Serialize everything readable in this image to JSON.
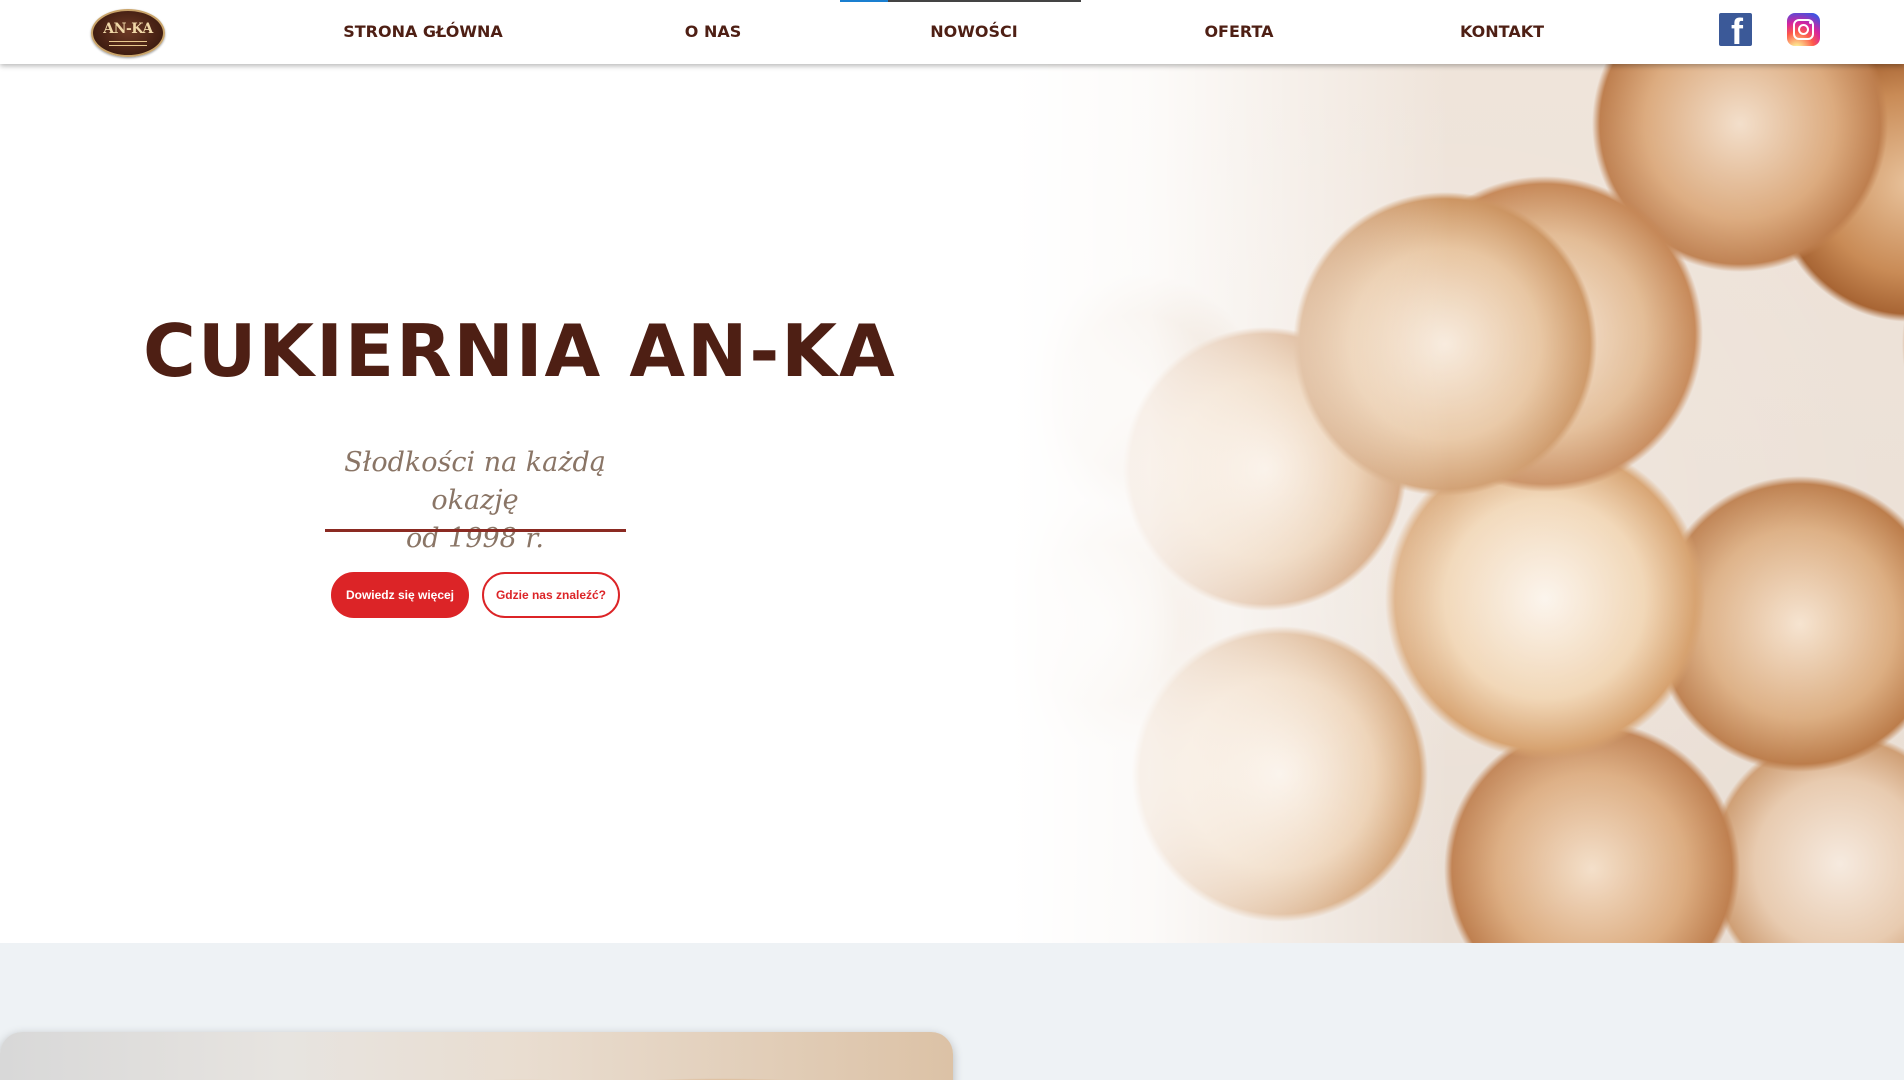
{
  "header": {
    "logo_text": "AN-KA",
    "nav": [
      {
        "label": "Strona główna"
      },
      {
        "label": "O nas"
      },
      {
        "label": "Nowości"
      },
      {
        "label": "Oferta"
      },
      {
        "label": "Kontakt"
      }
    ],
    "active_nav": "Nowości",
    "social": [
      {
        "name": "facebook-icon",
        "glyph": "f",
        "color": "#3b5998"
      },
      {
        "name": "instagram-icon",
        "color": "#d6249f"
      }
    ]
  },
  "hero": {
    "title": "Cukiernia AN-KA",
    "subtitle_line1": "Słodkości na każdą okazję",
    "subtitle_line2": "od 1998 r.",
    "primary_button": "Dowiedz się więcej",
    "secondary_button": "Gdzie nas znaleźć?"
  },
  "colors": {
    "brand_brown": "#4e1f14",
    "accent_red": "#dc2427",
    "underline": "#8b2a22",
    "section_bg": "#eef2f5"
  }
}
